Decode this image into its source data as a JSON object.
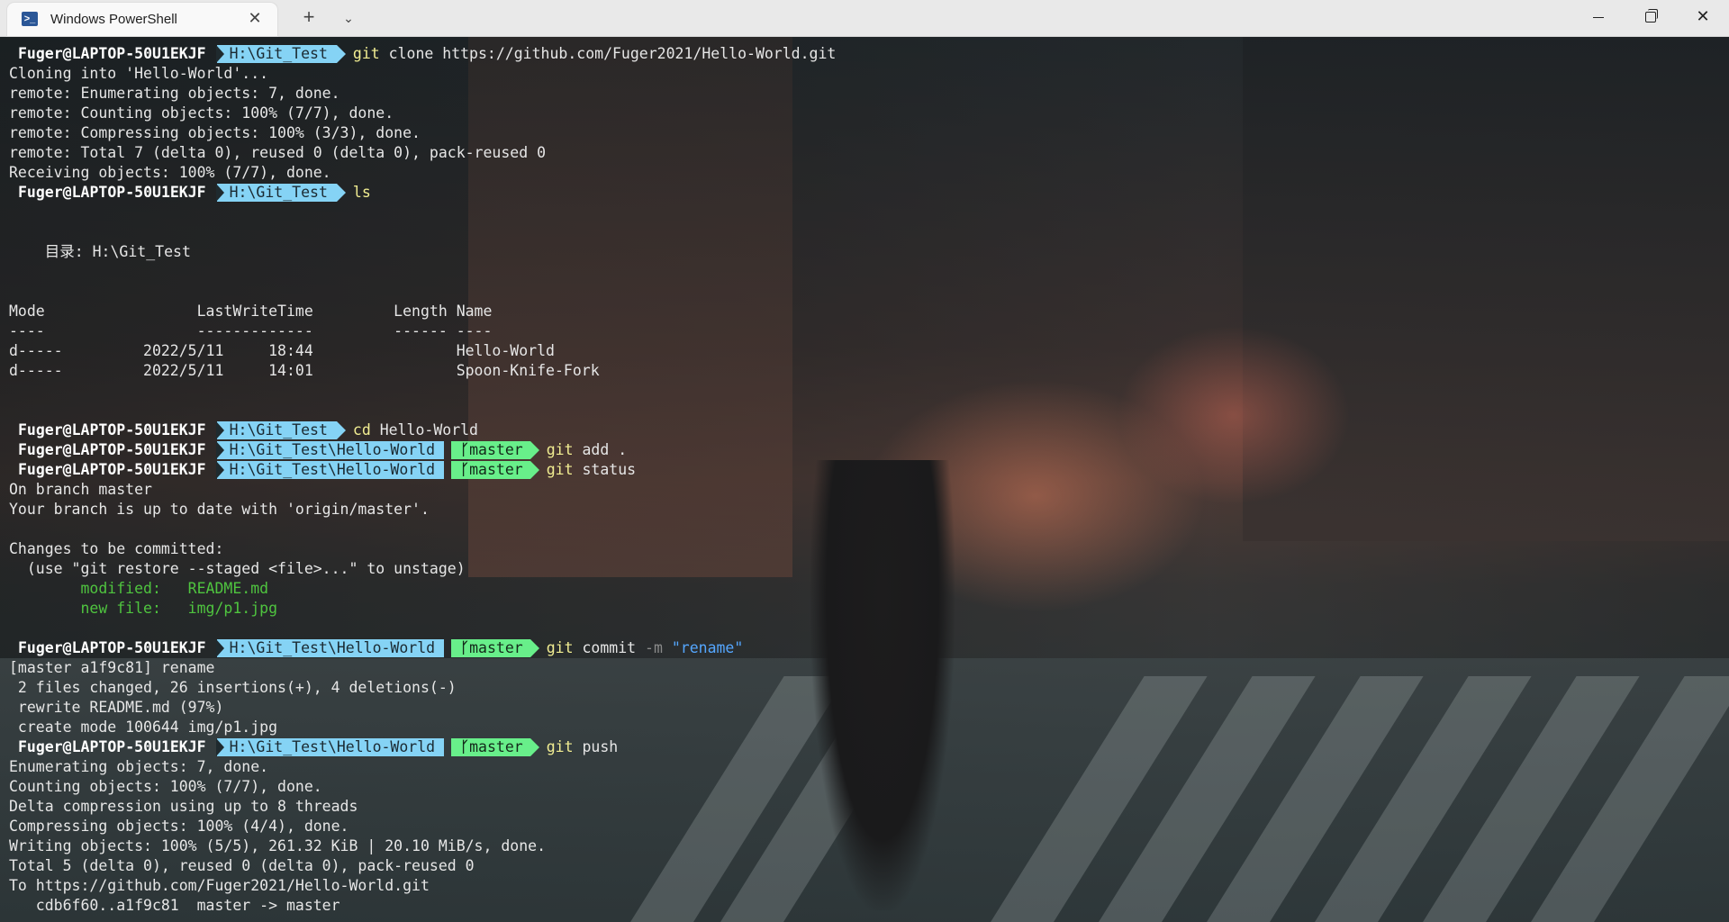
{
  "window": {
    "tab_title": "Windows PowerShell",
    "tab_icon_glyph": ">_",
    "close_glyph": "✕",
    "new_tab_glyph": "+",
    "dropdown_glyph": "⌄",
    "minimize_label": "",
    "maximize_label": "",
    "close_window_glyph": "✕"
  },
  "prompt": {
    "user": "Fuger@LAPTOP-50U1EKJF",
    "path_root": "H:\\Git_Test",
    "path_repo": "H:\\Git_Test\\Hello-World",
    "branch": "master",
    "branch_glyph": "ᚴ"
  },
  "output": {
    "clone_cmd": "git",
    "clone_args": "clone https://github.com/Fuger2021/Hello-World.git",
    "clone_lines": [
      "Cloning into 'Hello-World'...",
      "remote: Enumerating objects: 7, done.",
      "remote: Counting objects: 100% (7/7), done.",
      "remote: Compressing objects: 100% (3/3), done.",
      "remote: Total 7 (delta 0), reused 0 (delta 0), pack-reused 0",
      "Receiving objects: 100% (7/7), done."
    ],
    "ls_cmd": "ls",
    "dir_header": "    目录: H:\\Git_Test",
    "table_header": "Mode                 LastWriteTime         Length Name",
    "table_rule": "----                 -------------         ------ ----",
    "dir_rows": [
      "d-----         2022/5/11     18:44                Hello-World",
      "d-----         2022/5/11     14:01                Spoon-Knife-Fork"
    ],
    "cd_cmd": "cd",
    "cd_args": "Hello-World",
    "add_cmd": "git",
    "add_args": "add .",
    "status_cmd": "git",
    "status_args": "status",
    "status_lines": [
      "On branch master",
      "Your branch is up to date with 'origin/master'.",
      "",
      "Changes to be committed:",
      "  (use \"git restore --staged <file>...\" to unstage)"
    ],
    "staged": [
      "        modified:   README.md",
      "        new file:   img/p1.jpg"
    ],
    "commit_cmd": "git",
    "commit_args": "commit",
    "commit_flag": "-m",
    "commit_msg": "\"rename\"",
    "commit_lines": [
      "[master a1f9c81] rename",
      " 2 files changed, 26 insertions(+), 4 deletions(-)",
      " rewrite README.md (97%)",
      " create mode 100644 img/p1.jpg"
    ],
    "push_cmd": "git",
    "push_args": "push",
    "push_lines": [
      "Enumerating objects: 7, done.",
      "Counting objects: 100% (7/7), done.",
      "Delta compression using up to 8 threads",
      "Compressing objects: 100% (4/4), done.",
      "Writing objects: 100% (5/5), 261.32 KiB | 20.10 MiB/s, done.",
      "Total 5 (delta 0), reused 0 (delta 0), pack-reused 0",
      "To https://github.com/Fuger2021/Hello-World.git",
      "   cdb6f60..a1f9c81  master -> master"
    ]
  }
}
